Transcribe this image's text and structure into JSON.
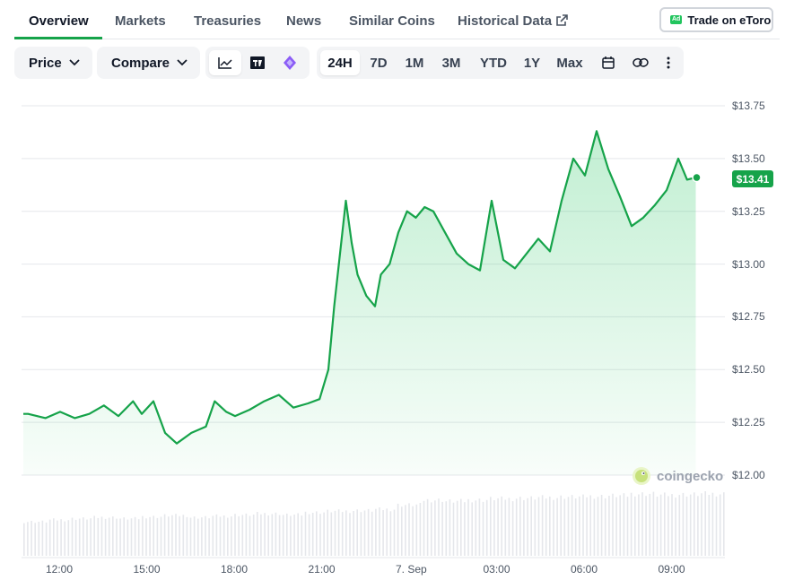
{
  "tabs": [
    {
      "label": "Overview",
      "active": true
    },
    {
      "label": "Markets"
    },
    {
      "label": "Treasuries"
    },
    {
      "label": "News"
    },
    {
      "label": "Similar Coins"
    },
    {
      "label": "Historical Data"
    }
  ],
  "cta": {
    "badge": "Ad",
    "label": "Trade on eToro"
  },
  "toolbar": {
    "price_label": "Price",
    "compare_label": "Compare",
    "chart_icons": [
      "line-chart-icon",
      "tradingview-icon",
      "crypto-logo-icon"
    ],
    "ranges": [
      "24H",
      "7D",
      "1M",
      "3M",
      "YTD",
      "1Y",
      "Max"
    ],
    "active_range": "24H",
    "tool_icons": [
      "calendar-icon",
      "link-icon",
      "more-icon"
    ]
  },
  "colors": {
    "accent": "#16a34a",
    "line": "#16a34a",
    "fill": "#dcfce7"
  },
  "current_price": "$13.41",
  "watermark": "coingecko",
  "chart_data": {
    "type": "area",
    "y_ticks": [
      "$13.75",
      "$13.50",
      "$13.25",
      "$13.00",
      "$12.75",
      "$12.50",
      "$12.25",
      "$12.00"
    ],
    "x_ticks": [
      "12:00",
      "15:00",
      "18:00",
      "21:00",
      "7. Sep",
      "03:00",
      "06:00",
      "09:00"
    ],
    "ylim": [
      12.0,
      13.75
    ],
    "x": [
      10.9,
      11.5,
      12.0,
      12.5,
      13.0,
      13.5,
      14.0,
      14.5,
      14.8,
      15.2,
      15.6,
      16.0,
      16.5,
      17.0,
      17.3,
      17.7,
      18.0,
      18.5,
      19.0,
      19.5,
      20.0,
      20.5,
      20.9,
      21.2,
      21.4,
      21.6,
      21.8,
      22.0,
      22.2,
      22.5,
      22.8,
      23.0,
      23.3,
      23.6,
      23.9,
      24.2,
      24.5,
      24.8,
      25.2,
      25.6,
      26.0,
      26.4,
      26.8,
      27.2,
      27.6,
      28.0,
      28.4,
      28.8,
      29.2,
      29.6,
      30.0,
      30.4,
      30.8,
      31.2,
      31.6,
      32.0,
      32.4,
      32.8,
      33.2,
      33.5,
      33.8
    ],
    "y": [
      12.29,
      12.27,
      12.3,
      12.27,
      12.29,
      12.33,
      12.28,
      12.35,
      12.29,
      12.35,
      12.2,
      12.15,
      12.2,
      12.23,
      12.35,
      12.3,
      12.28,
      12.31,
      12.35,
      12.38,
      12.32,
      12.34,
      12.36,
      12.5,
      12.8,
      13.05,
      13.3,
      13.1,
      12.95,
      12.85,
      12.8,
      12.95,
      13.0,
      13.15,
      13.25,
      13.22,
      13.27,
      13.25,
      13.15,
      13.05,
      13.0,
      12.97,
      13.3,
      13.02,
      12.98,
      13.05,
      13.12,
      13.06,
      13.3,
      13.5,
      13.42,
      13.63,
      13.45,
      13.32,
      13.18,
      13.22,
      13.28,
      13.35,
      13.5,
      13.4,
      13.41
    ],
    "volume_level": [
      0.55,
      0.58,
      0.6,
      0.62,
      0.6,
      0.63,
      0.65,
      0.62,
      0.64,
      0.66,
      0.68,
      0.66,
      0.7,
      0.72,
      0.73,
      0.75,
      0.82,
      0.9,
      0.88,
      0.9,
      0.92,
      0.93,
      0.94,
      0.95,
      0.96,
      0.97,
      1.0,
      0.98,
      0.99,
      1.0
    ]
  }
}
